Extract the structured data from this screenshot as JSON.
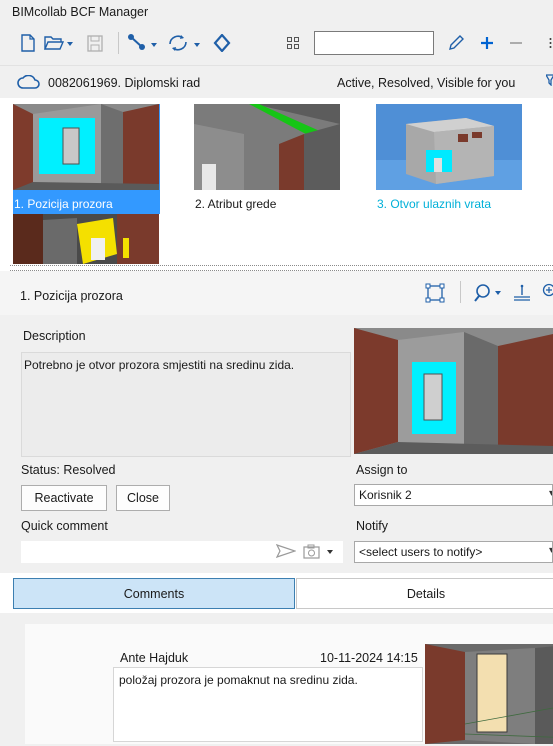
{
  "window": {
    "title": "BIMcollab BCF Manager"
  },
  "toolbar": {
    "icons": [
      "new-file-icon",
      "open-folder-icon",
      "save-icon",
      "connect-icon",
      "sync-icon",
      "server-icon",
      "grid-view-icon",
      "edit-pencil-icon",
      "add-plus-icon",
      "remove-minus-icon"
    ],
    "search_value": ""
  },
  "project": {
    "name": "0082061969. Diplomski rad",
    "filter": "Active, Resolved, Visible for you"
  },
  "issues": [
    {
      "label": "1. Pozicija prozora",
      "selected": true
    },
    {
      "label": "2. Atribut grede",
      "selected": false
    },
    {
      "label": "3. Otvor ulaznih vrata",
      "selected": false
    }
  ],
  "detail": {
    "title": "1. Pozicija prozora",
    "description_label": "Description",
    "description": "Potrebno je otvor prozora smjestiti na sredinu zida.",
    "status": "Status: Resolved",
    "reactivate_label": "Reactivate",
    "close_label": "Close",
    "assign_label": "Assign to",
    "assign_value": "Korisnik 2",
    "quick_comment_label": "Quick comment",
    "quick_comment_value": "",
    "notify_label": "Notify",
    "notify_value": "<select users to notify>"
  },
  "tabs": [
    {
      "label": "Comments",
      "active": true
    },
    {
      "label": "Details",
      "active": false
    }
  ],
  "comment": {
    "author": "Ante Hajduk",
    "date": "10-11-2024 14:15",
    "text": "položaj prozora je pomaknut na sredinu zida."
  },
  "colors": {
    "selection": "#3399ff",
    "accent_blue": "#0063b1",
    "tab_active": "#cce4f7",
    "cyan_wall": "#00e5ff",
    "brick": "#7a3a2c"
  }
}
